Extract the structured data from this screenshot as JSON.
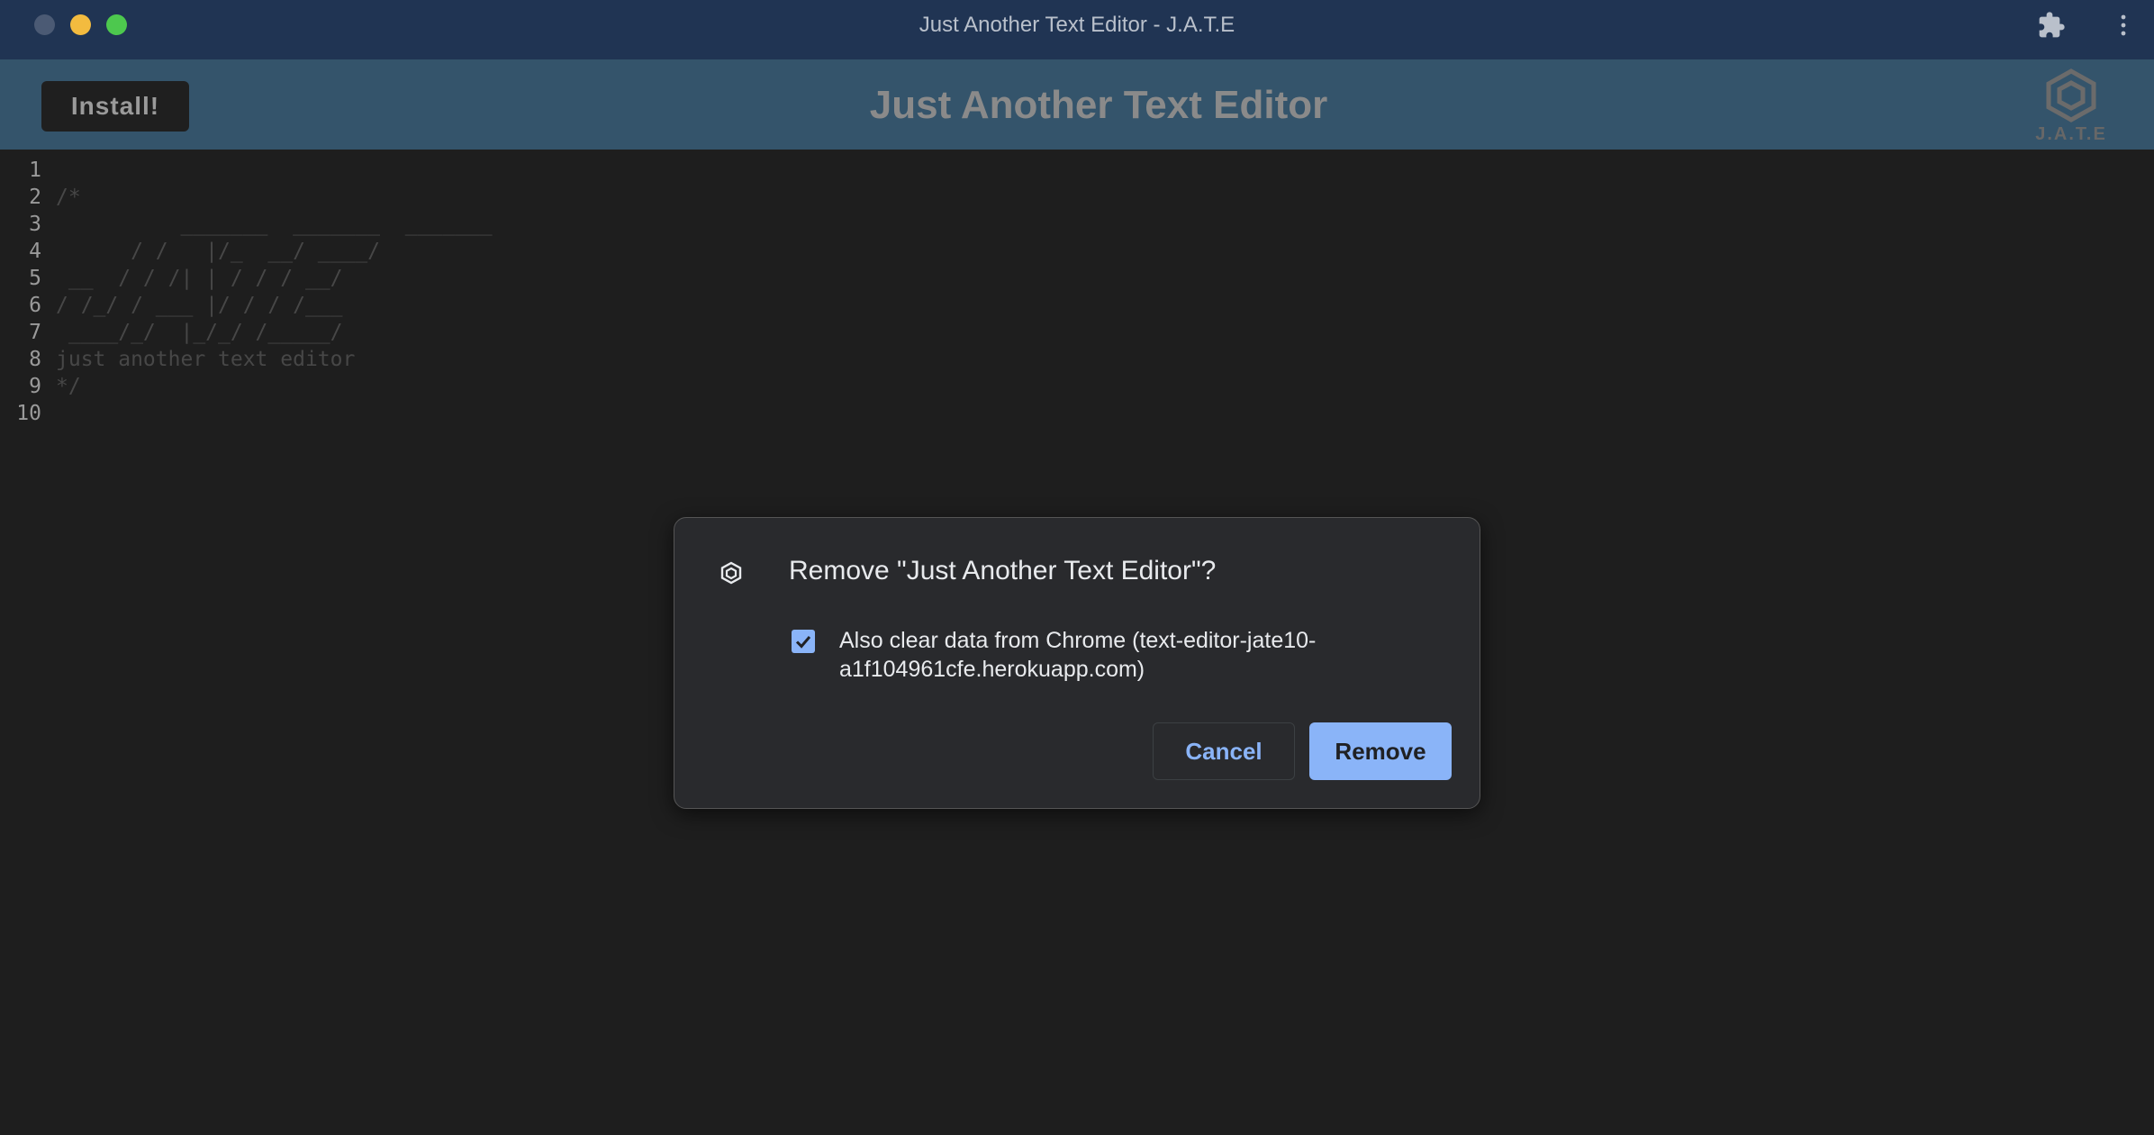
{
  "window": {
    "title": "Just Another Text Editor - J.A.T.E"
  },
  "app": {
    "install_label": "Install!",
    "title": "Just Another Text Editor",
    "logo_text": "J.A.T.E"
  },
  "editor": {
    "lines": [
      {
        "num": "1",
        "text": ""
      },
      {
        "num": "2",
        "text": "/*"
      },
      {
        "num": "3",
        "text": "          _______  _______  _______"
      },
      {
        "num": "4",
        "text": "      / /   |/_  __/ ____/"
      },
      {
        "num": "5",
        "text": " __  / / /| | / / / __/"
      },
      {
        "num": "6",
        "text": "/ /_/ / ___ |/ / / /___"
      },
      {
        "num": "7",
        "text": " ____/_/  |_/_/ /_____/"
      },
      {
        "num": "8",
        "text": "just another text editor"
      },
      {
        "num": "9",
        "text": "*/"
      },
      {
        "num": "10",
        "text": ""
      }
    ]
  },
  "dialog": {
    "title": "Remove \"Just Another Text Editor\"?",
    "checkbox_label": "Also clear data from Chrome (text-editor-jate10-a1f104961cfe.herokuapp.com)",
    "checkbox_checked": true,
    "cancel_label": "Cancel",
    "remove_label": "Remove"
  },
  "colors": {
    "titlebar": "#203453",
    "header": "#34546b",
    "editor_bg": "#1e1e1e",
    "dialog_bg": "#292a2d",
    "accent": "#8ab4f8"
  },
  "icons": {
    "titlebar_right": [
      "puzzle-icon",
      "more-vertical-icon"
    ],
    "app_logo": "jate-logo",
    "dialog": "jate-app-icon"
  }
}
